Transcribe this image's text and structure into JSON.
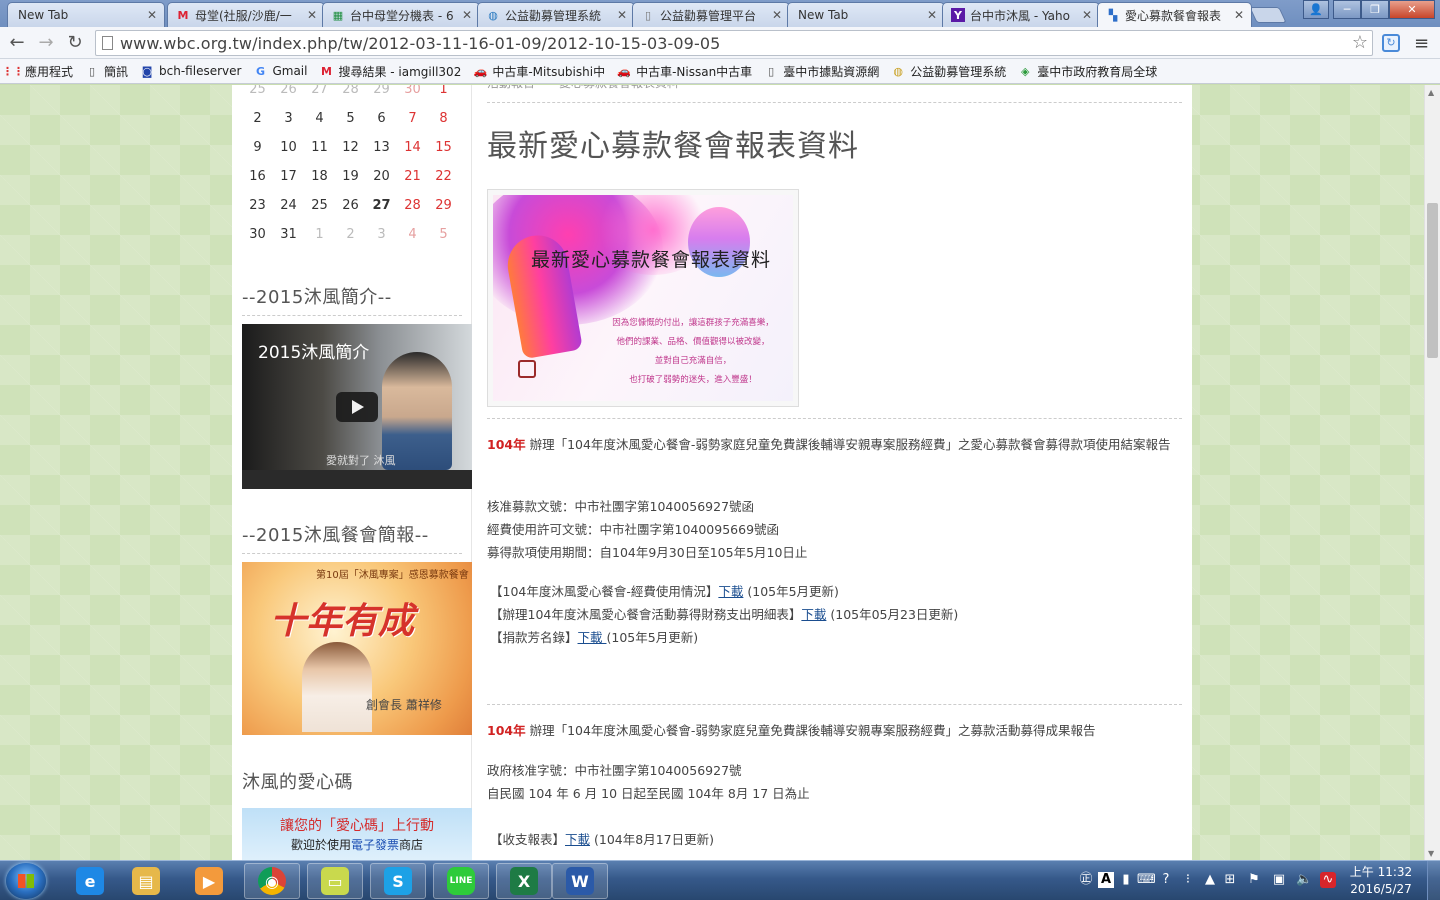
{
  "browser": {
    "tabs": [
      {
        "label": "New Tab",
        "icon": "blank-icon"
      },
      {
        "label": "母堂(社服/沙鹿/一",
        "icon": "gmail-icon"
      },
      {
        "label": "台中母堂分機表 - 6",
        "icon": "sheets-icon"
      },
      {
        "label": "公益勸募管理系統",
        "icon": "globe-icon"
      },
      {
        "label": "公益勸募管理平台",
        "icon": "page-icon"
      },
      {
        "label": "New Tab",
        "icon": "blank-icon"
      },
      {
        "label": "台中市沐風 - Yaho",
        "icon": "yahoo-icon"
      },
      {
        "label": "愛心募款餐會報表",
        "icon": "site-icon"
      }
    ],
    "url": "www.wbc.org.tw/index.php/tw/2012-03-11-16-01-09/2012-10-15-03-09-05",
    "bookmarks": [
      {
        "label": "應用程式",
        "icon": "apps-icon"
      },
      {
        "label": "簡訊",
        "icon": "page-icon"
      },
      {
        "label": "bch-fileserver",
        "icon": "server-icon"
      },
      {
        "label": "Gmail",
        "icon": "google-icon"
      },
      {
        "label": "搜尋結果 - iamgill302",
        "icon": "gmail-icon"
      },
      {
        "label": "中古車-Mitsubishi中",
        "icon": "car-icon"
      },
      {
        "label": "中古車-Nissan中古車",
        "icon": "car-icon"
      },
      {
        "label": "臺中市據點資源網",
        "icon": "page-icon"
      },
      {
        "label": "公益勸募管理系統",
        "icon": "globe-icon"
      },
      {
        "label": "臺中市政府教育局全球",
        "icon": "edu-icon"
      }
    ]
  },
  "sidebar": {
    "calendar": [
      [
        {
          "d": "25",
          "m": true
        },
        {
          "d": "26",
          "m": true
        },
        {
          "d": "27",
          "m": true
        },
        {
          "d": "28",
          "m": true
        },
        {
          "d": "29",
          "m": true
        },
        {
          "d": "30",
          "m": true
        },
        {
          "d": "1",
          "r": true
        }
      ],
      [
        {
          "d": "2"
        },
        {
          "d": "3"
        },
        {
          "d": "4"
        },
        {
          "d": "5"
        },
        {
          "d": "6"
        },
        {
          "d": "7",
          "r": true
        },
        {
          "d": "8",
          "r": true
        }
      ],
      [
        {
          "d": "9"
        },
        {
          "d": "10"
        },
        {
          "d": "11"
        },
        {
          "d": "12"
        },
        {
          "d": "13"
        },
        {
          "d": "14",
          "r": true
        },
        {
          "d": "15",
          "r": true
        }
      ],
      [
        {
          "d": "16"
        },
        {
          "d": "17"
        },
        {
          "d": "18"
        },
        {
          "d": "19"
        },
        {
          "d": "20"
        },
        {
          "d": "21",
          "r": true
        },
        {
          "d": "22",
          "r": true
        }
      ],
      [
        {
          "d": "23"
        },
        {
          "d": "24"
        },
        {
          "d": "25"
        },
        {
          "d": "26"
        },
        {
          "d": "27",
          "t": true
        },
        {
          "d": "28",
          "r": true
        },
        {
          "d": "29",
          "r": true
        }
      ],
      [
        {
          "d": "30"
        },
        {
          "d": "31"
        },
        {
          "d": "1",
          "m": true
        },
        {
          "d": "2",
          "m": true
        },
        {
          "d": "3",
          "m": true
        },
        {
          "d": "4",
          "m": true
        },
        {
          "d": "5",
          "m": true
        }
      ]
    ],
    "intro_heading": "--2015沐風簡介--",
    "video_title": "2015沐風簡介",
    "video_caption": "愛就對了 沐風",
    "dinner_heading": "--2015沐風餐會簡報--",
    "banner_top": "第10屆「沐風專案」感恩募款餐會",
    "banner_main": "十年有成",
    "banner_sig": "創會長 蕭祥修",
    "code_heading": "沐風的愛心碼",
    "code_line1": "讓您的「愛心碼」上行動",
    "code_line2_a": "歡迎於使用",
    "code_line2_b": "電子發票",
    "code_line2_c": "商店"
  },
  "content": {
    "breadcrumb": "活動報告　　愛心募款餐會報表資料",
    "title": "最新愛心募款餐會報表資料",
    "hero_title": "最新愛心募款餐會報表資料",
    "hero_lines": [
      "因為您慷慨的付出，讓這群孩子充滿喜樂，",
      "他們的課業、品格、價值觀得以被改變，",
      "並對自己充滿自信，",
      "也打破了弱勢的迷失，進入豐盛！"
    ],
    "section1": {
      "year": "104年",
      "desc": " 辦理「104年度沐風愛心餐會-弱勢家庭兒童免費課後輔導安親專案服務經費」之愛心募款餐會募得款項使用結案報告",
      "lines": [
        "核准募款文號：中市社團字第1040056927號函",
        "經費使用許可文號：中市社團字第1040095669號函",
        "募得款項使用期間：自104年9月30日至105年5月10日止"
      ],
      "downloads": [
        {
          "pre": "【104年度沐風愛心餐會-經費使用情況】",
          "link": "下載",
          "post": " (105年5月更新)"
        },
        {
          "pre": "【辦理104年度沐風愛心餐會活動募得財務支出明細表】",
          "link": "下載",
          "post": " (105年05月23日更新)"
        },
        {
          "pre": "【捐款芳名錄】",
          "link": "下載 ",
          "post": "(105年5月更新)"
        }
      ]
    },
    "section2": {
      "year": "104年",
      "desc": " 辦理「104年度沐風愛心餐會-弱勢家庭兒童免費課後輔導安親專案服務經費」之募款活動募得成果報告",
      "lines": [
        "政府核准字號：中市社團字第1040056927號",
        "自民國 104 年 6 月 10 日起至民國 104年 8月 17 日為止"
      ],
      "downloads": [
        {
          "pre": "【收支報表】",
          "link": "下載",
          "post": " (104年8月17日更新)"
        }
      ]
    }
  },
  "taskbar": {
    "apps": [
      {
        "name": "ie-icon",
        "glyph": "e",
        "color": "#1e88e5"
      },
      {
        "name": "explorer-icon",
        "glyph": "▤",
        "color": "#e6b84a"
      },
      {
        "name": "media-player-icon",
        "glyph": "▶",
        "color": "#f39a3c"
      },
      {
        "name": "chrome-icon",
        "glyph": "◉",
        "color": "#e54135"
      },
      {
        "name": "sticky-notes-icon",
        "glyph": "▭",
        "color": "#c9d94d"
      },
      {
        "name": "skype-icon",
        "glyph": "S",
        "color": "#1da1e6"
      },
      {
        "name": "line-icon",
        "glyph": "LINE",
        "color": "#2ecb3a"
      },
      {
        "name": "excel-icon",
        "glyph": "X",
        "color": "#1e7b45"
      },
      {
        "name": "word-icon",
        "glyph": "W",
        "color": "#2b5aa8"
      }
    ],
    "time": "上午 11:32",
    "date": "2016/5/27"
  }
}
